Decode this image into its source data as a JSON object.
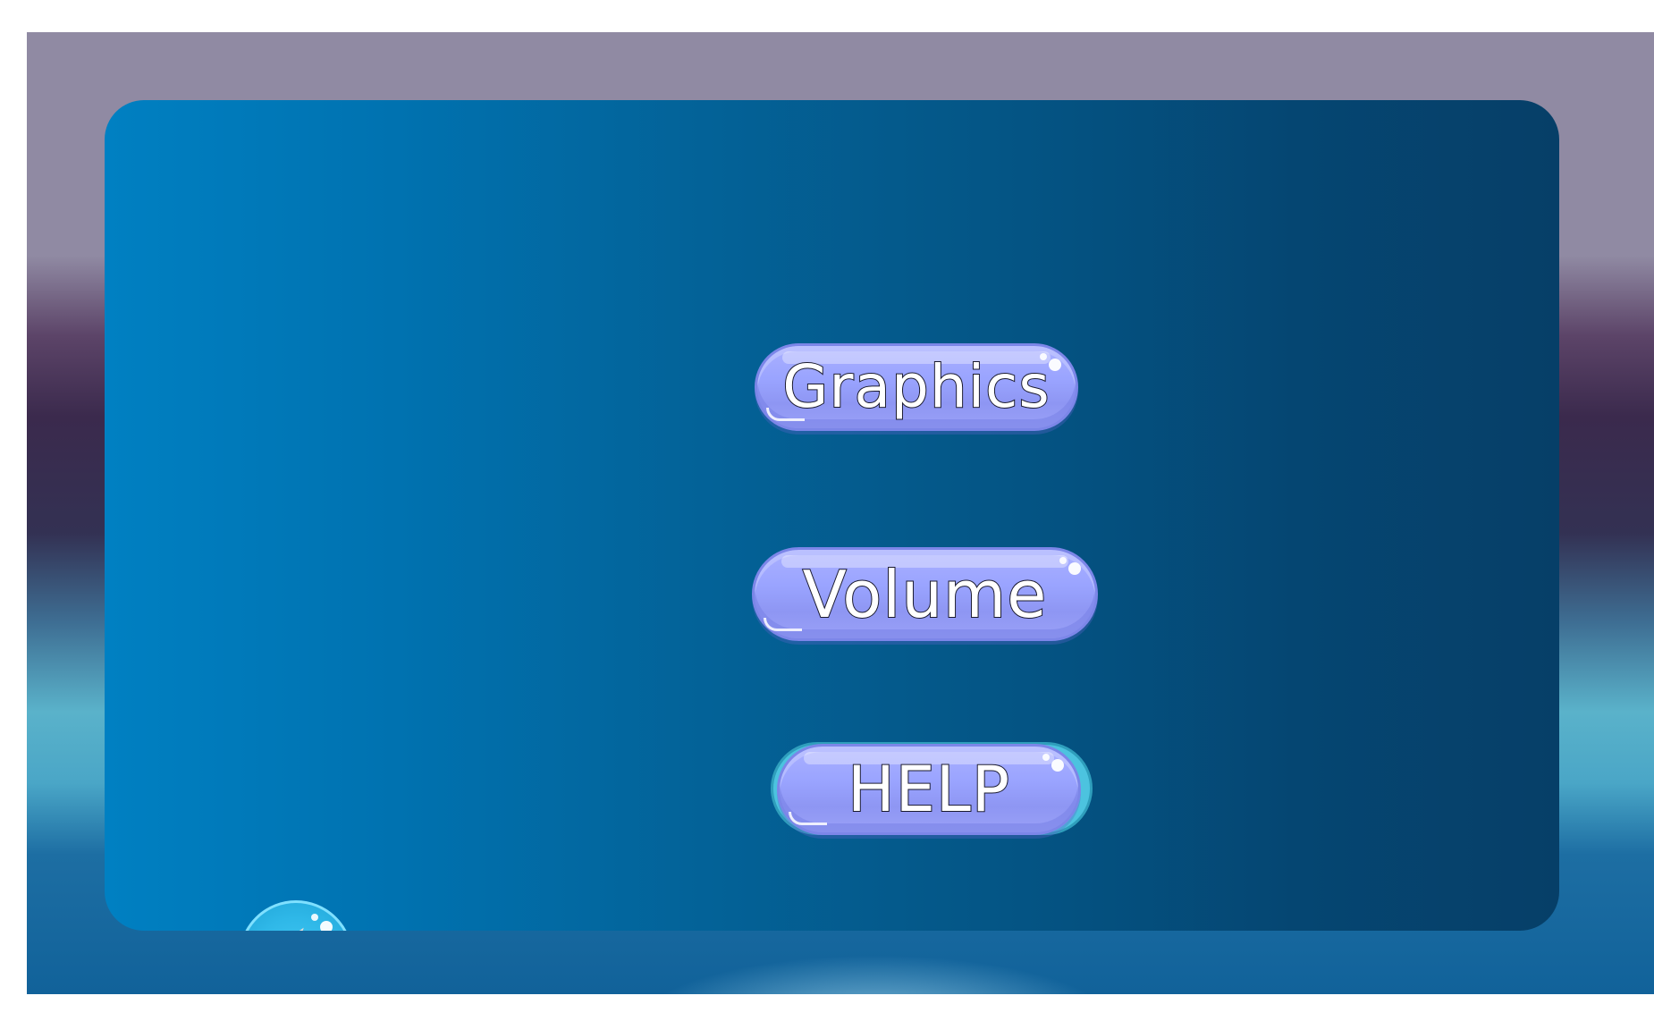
{
  "menu": {
    "graphics_label": "Graphics",
    "volume_label": "Volume",
    "help_label": "HELP"
  },
  "icons": {
    "back": "back-arrow-icon"
  },
  "colors": {
    "panel_left": "#0080c2",
    "panel_right": "#063f68",
    "button_fill": "#9aa4ff",
    "back_button": "#2fb8e8"
  }
}
